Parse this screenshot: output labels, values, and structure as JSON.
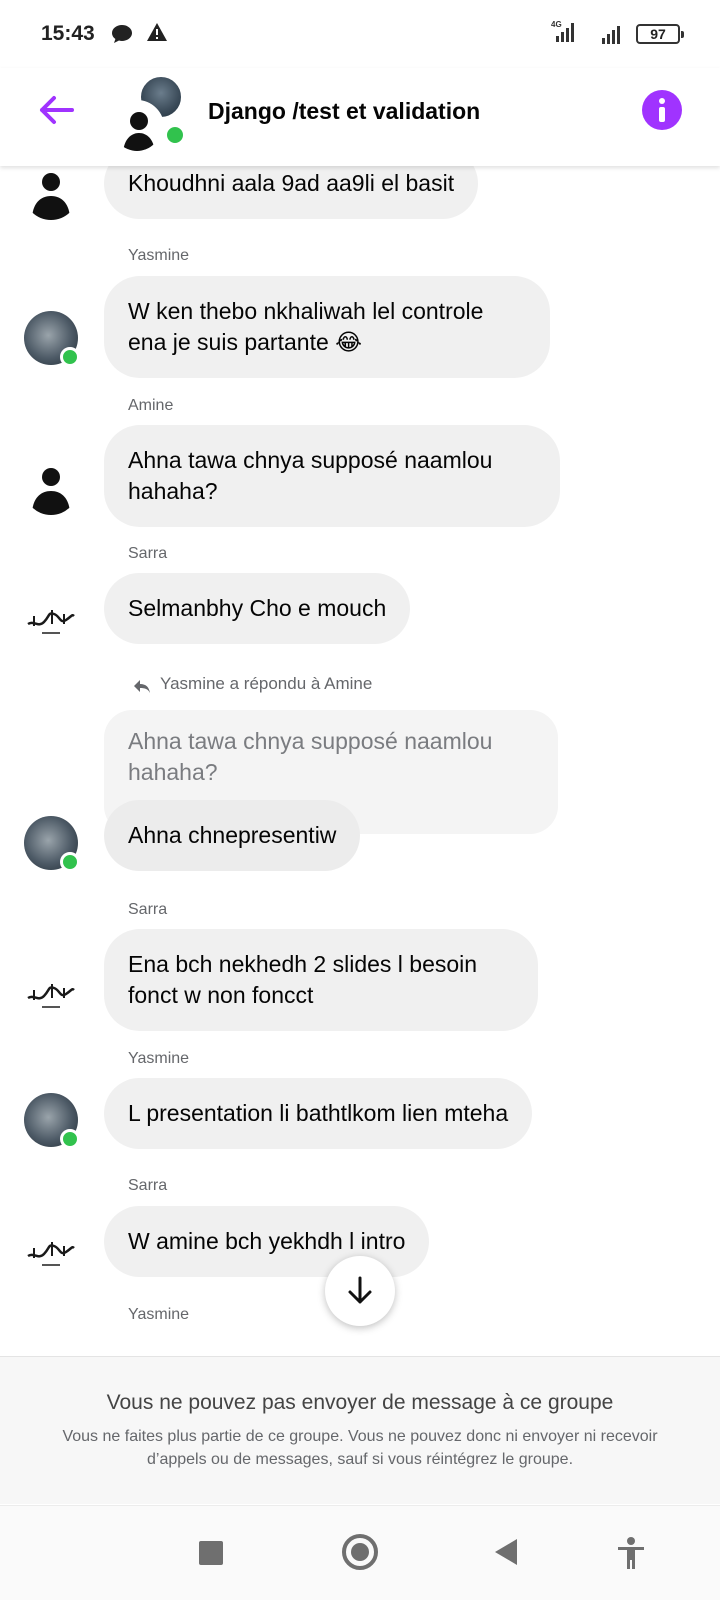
{
  "status_bar": {
    "time": "15:43",
    "network": "4G",
    "battery": "97"
  },
  "header": {
    "title": "Django /test et validation"
  },
  "messages": [
    {
      "sender": "",
      "text": "Khoudhni aala 9ad aa9li el basit"
    },
    {
      "sender": "Yasmine",
      "text": "W ken thebo nkhaliwah lel controle ena je suis partante 😂"
    },
    {
      "sender": "Amine",
      "text": "Ahna tawa chnya supposé naamlou hahaha?"
    },
    {
      "sender": "Sarra",
      "text": "Selmanbhy Cho e mouch"
    },
    {
      "sender": "",
      "reply_note": "Yasmine a répondu à Amine",
      "quoted": "Ahna tawa chnya supposé naamlou hahaha?",
      "text": "Ahna chnepresentiw"
    },
    {
      "sender": "Sarra",
      "text": "Ena bch nekhedh 2 slides l besoin fonct w non foncct"
    },
    {
      "sender": "Yasmine",
      "text": "L presentation li bathtlkom lien mteha"
    },
    {
      "sender": "Sarra",
      "text": "W amine bch yekhdh l intro"
    },
    {
      "sender": "Yasmine",
      "text": ""
    }
  ],
  "notice": {
    "title": "Vous ne pouvez pas envoyer de message à ce groupe",
    "body": "Vous ne faites plus partie de ce groupe. Vous ne pouvez donc ni envoyer ni recevoir d’appels ou de messages, sauf si vous réintégrez le groupe."
  },
  "colors": {
    "accent": "#a033ff",
    "online": "#31c24d",
    "bubble": "#f0f0f0"
  },
  "icons": [
    "back-arrow-icon",
    "info-icon",
    "scroll-down-icon",
    "reply-icon",
    "stop-nav-icon",
    "home-nav-icon",
    "back-nav-icon",
    "accessibility-icon"
  ]
}
